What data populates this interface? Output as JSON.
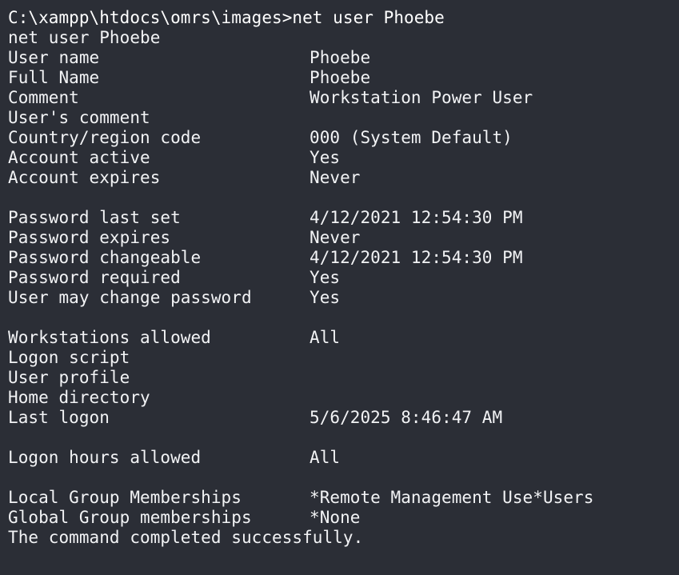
{
  "terminal": {
    "background": "#2b2e36",
    "foreground": "#f2f3f5",
    "prompt_line": "C:\\xampp\\htdocs\\omrs\\images>net user Phoebe",
    "echo_line": "net user Phoebe",
    "rows": [
      {
        "label": "User name",
        "value": "Phoebe"
      },
      {
        "label": "Full Name",
        "value": "Phoebe"
      },
      {
        "label": "Comment",
        "value": "Workstation Power User"
      },
      {
        "label": "User's comment",
        "value": ""
      },
      {
        "label": "Country/region code",
        "value": "000 (System Default)"
      },
      {
        "label": "Account active",
        "value": "Yes"
      },
      {
        "label": "Account expires",
        "value": "Never"
      },
      {
        "label": "Password last set",
        "value": "4/12/2021 12:54:30 PM"
      },
      {
        "label": "Password expires",
        "value": "Never"
      },
      {
        "label": "Password changeable",
        "value": "4/12/2021 12:54:30 PM"
      },
      {
        "label": "Password required",
        "value": "Yes"
      },
      {
        "label": "User may change password",
        "value": "Yes"
      },
      {
        "label": "Workstations allowed",
        "value": "All"
      },
      {
        "label": "Logon script",
        "value": ""
      },
      {
        "label": "User profile",
        "value": ""
      },
      {
        "label": "Home directory",
        "value": ""
      },
      {
        "label": "Last logon",
        "value": "5/6/2025 8:46:47 AM"
      },
      {
        "label": "Logon hours allowed",
        "value": "All"
      },
      {
        "label": "Local Group Memberships",
        "value": "*Remote Management Use*Users"
      },
      {
        "label": "Global Group memberships",
        "value": "*None"
      }
    ],
    "completion_line": "The command completed successfully."
  }
}
